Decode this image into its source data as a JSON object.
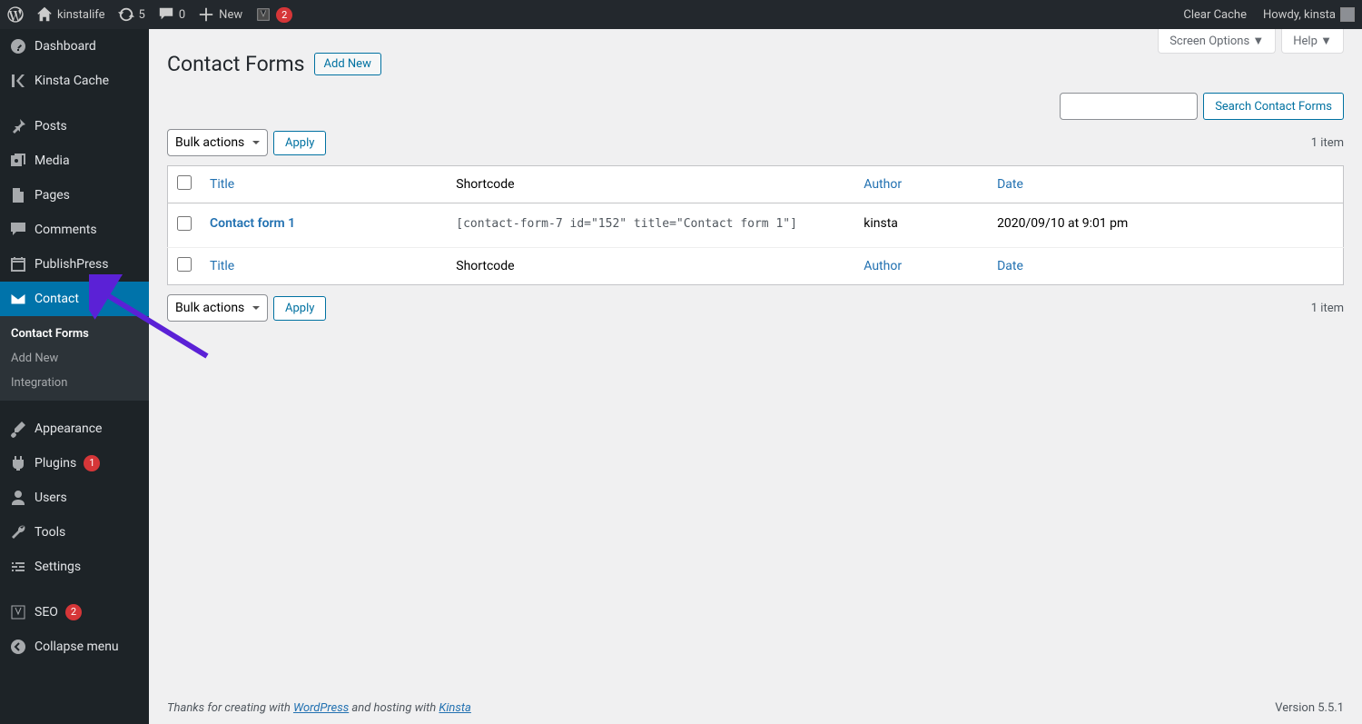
{
  "adminbar": {
    "site_name": "kinstalife",
    "updates": "5",
    "comments": "0",
    "new_label": "New",
    "yoast_badge": "2",
    "clear_cache": "Clear Cache",
    "howdy": "Howdy, kinsta"
  },
  "sidebar": {
    "dashboard": "Dashboard",
    "kinsta_cache": "Kinsta Cache",
    "posts": "Posts",
    "media": "Media",
    "pages": "Pages",
    "comments": "Comments",
    "publishpress": "PublishPress",
    "contact": "Contact",
    "appearance": "Appearance",
    "plugins": "Plugins",
    "plugins_count": "1",
    "users": "Users",
    "tools": "Tools",
    "settings": "Settings",
    "seo": "SEO",
    "seo_count": "2",
    "collapse": "Collapse menu"
  },
  "submenu": {
    "contact_forms": "Contact Forms",
    "add_new": "Add New",
    "integration": "Integration"
  },
  "page": {
    "title": "Contact Forms",
    "add_new": "Add New",
    "screen_options": "Screen Options ▼",
    "help": "Help ▼",
    "search_button": "Search Contact Forms",
    "bulk_actions": "Bulk actions",
    "apply": "Apply",
    "item_count": "1 item"
  },
  "table": {
    "col_title": "Title",
    "col_shortcode": "Shortcode",
    "col_author": "Author",
    "col_date": "Date",
    "rows": [
      {
        "title": "Contact form 1",
        "shortcode": "[contact-form-7 id=\"152\" title=\"Contact form 1\"]",
        "author": "kinsta",
        "date": "2020/09/10 at 9:01 pm"
      }
    ]
  },
  "footer": {
    "prefix": "Thanks for creating with ",
    "wp": "WordPress",
    "mid": " and hosting with ",
    "kinsta": "Kinsta",
    "version": "Version 5.5.1"
  }
}
